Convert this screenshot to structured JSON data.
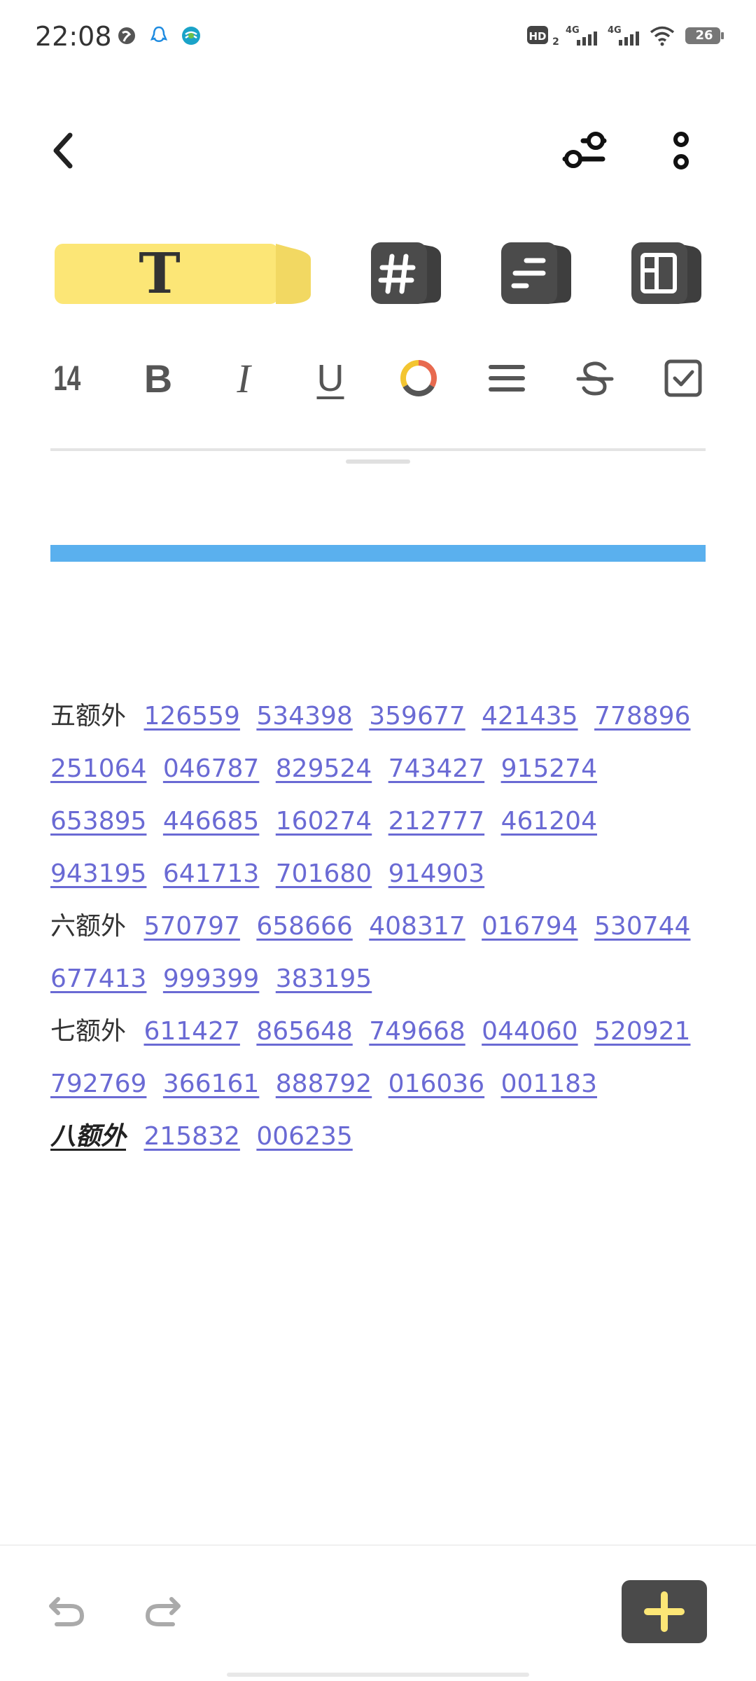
{
  "status_bar": {
    "time": "22:08",
    "icons_left": [
      "globe-icon",
      "qq-icon",
      "china-mobile-icon"
    ],
    "hd_label": "HD",
    "hd_sub": "2",
    "network1": "4G",
    "network2": "4G",
    "battery": "26"
  },
  "toolbar": {
    "back_icon": "chevron-left-icon",
    "settings_icon": "sliders-icon",
    "more_icon": "more-vertical-icon"
  },
  "modes": [
    {
      "name": "text",
      "symbol": "T",
      "active": true
    },
    {
      "name": "tag",
      "symbol": "#",
      "active": false
    },
    {
      "name": "list",
      "symbol": "list",
      "active": false
    },
    {
      "name": "layout",
      "symbol": "layout",
      "active": false
    }
  ],
  "format": {
    "font_size": "14",
    "bold": "B",
    "italic": "I",
    "underline": "U"
  },
  "colors": {
    "accent_yellow": "#fce676",
    "dark_tile": "#4a4a4a",
    "link_blue": "#6a6ad4",
    "blue_bar": "#5ab0ee"
  },
  "note": {
    "paragraphs": [
      {
        "label": "五额外",
        "numbers": [
          "126559",
          "534398",
          "359677",
          "421435",
          "778896",
          "251064",
          "046787",
          "829524",
          "743427",
          "915274",
          "653895",
          "446685",
          "160274",
          "212777",
          "461204",
          "943195",
          "641713",
          "701680",
          "914903"
        ]
      },
      {
        "label": "六额外",
        "numbers": [
          "570797",
          "658666",
          "408317",
          "016794",
          "530744",
          "677413",
          "999399",
          "383195"
        ]
      },
      {
        "label": "七额外",
        "numbers": [
          "611427",
          "865648",
          "749668",
          "044060",
          "520921",
          "792769",
          "366161",
          "888792",
          "016036",
          "001183"
        ]
      },
      {
        "label": "八额外",
        "numbers": [
          "215832",
          "006235"
        ]
      }
    ]
  }
}
